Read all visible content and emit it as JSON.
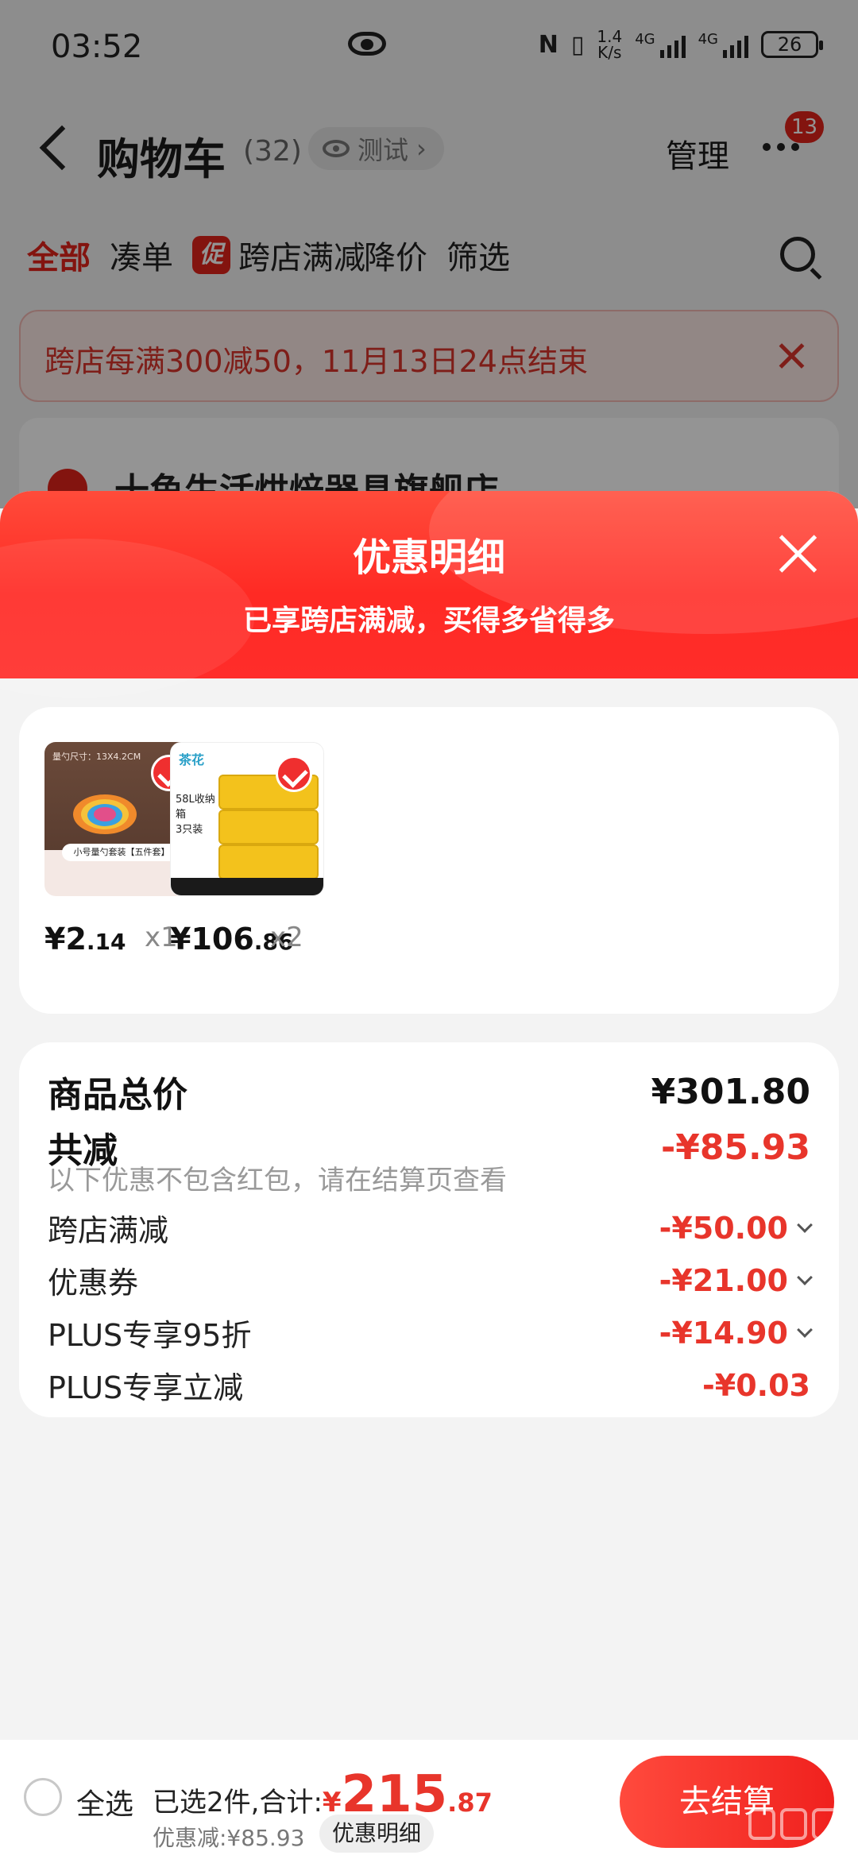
{
  "status_bar": {
    "time": "03:52",
    "speed_value": "1.4",
    "speed_unit": "K/s",
    "network_1": "4G",
    "network_2": "4G",
    "battery": "26",
    "icons": [
      "eye-icon",
      "nfc-icon",
      "vibrate-icon",
      "signal-icon",
      "battery-icon"
    ]
  },
  "nav": {
    "title": "购物车",
    "count": "(32)",
    "env_label": "测试",
    "manage": "管理",
    "message_badge": "13"
  },
  "filter_tabs": [
    {
      "label": "全部",
      "active": true
    },
    {
      "label": "凑单",
      "active": false
    },
    {
      "label": "跨店满减",
      "active": false,
      "tag": "促"
    },
    {
      "label": "降价",
      "active": false
    },
    {
      "label": "筛选",
      "active": false
    }
  ],
  "promo_banner": {
    "text": "跨店每满300减50，11月13日24点结束"
  },
  "store": {
    "name": "十鱼生活烘焙器具旗舰店"
  },
  "sheet": {
    "title": "优惠明细",
    "subtitle": "已享跨店满减，买得多省得多"
  },
  "products": [
    {
      "price_symbol": "¥",
      "price_int": "2",
      "price_dec": ".14",
      "qty": "x1",
      "thumb_caption": "小号量勺套装【五件套】",
      "thumb_top": "量勺尺寸：13X4.2CM"
    },
    {
      "price_symbol": "¥",
      "price_int": "106",
      "price_dec": ".86",
      "qty": "x2",
      "thumb_caption": "58L收纳箱\n3只装",
      "thumb_brand": "茶花"
    }
  ],
  "summary": {
    "total_label": "商品总价",
    "total_value": "¥301.80",
    "reduce_label": "共减",
    "reduce_value": "-¥85.93",
    "note": "以下优惠不包含红包，请在结算页查看",
    "items": [
      {
        "label": "跨店满减",
        "value": "-¥50.00",
        "expandable": true
      },
      {
        "label": "优惠券",
        "value": "-¥21.00",
        "expandable": true
      },
      {
        "label": "PLUS专享95折",
        "value": "-¥14.90",
        "expandable": true
      },
      {
        "label": "PLUS专享立减",
        "value": "-¥0.03",
        "expandable": false
      }
    ]
  },
  "bottom_bar": {
    "select_all": "全选",
    "selected_prefix": "已选2件,合计:",
    "total_symbol": "¥",
    "total_int": "215",
    "total_dec": ".87",
    "discount": "优惠减:¥85.93",
    "detail_chip": "优惠明细",
    "checkout": "去结算"
  },
  "colors": {
    "brand_red": "#e2231a",
    "price_red": "#e8352b",
    "sheet_header": "#ff2a24"
  }
}
